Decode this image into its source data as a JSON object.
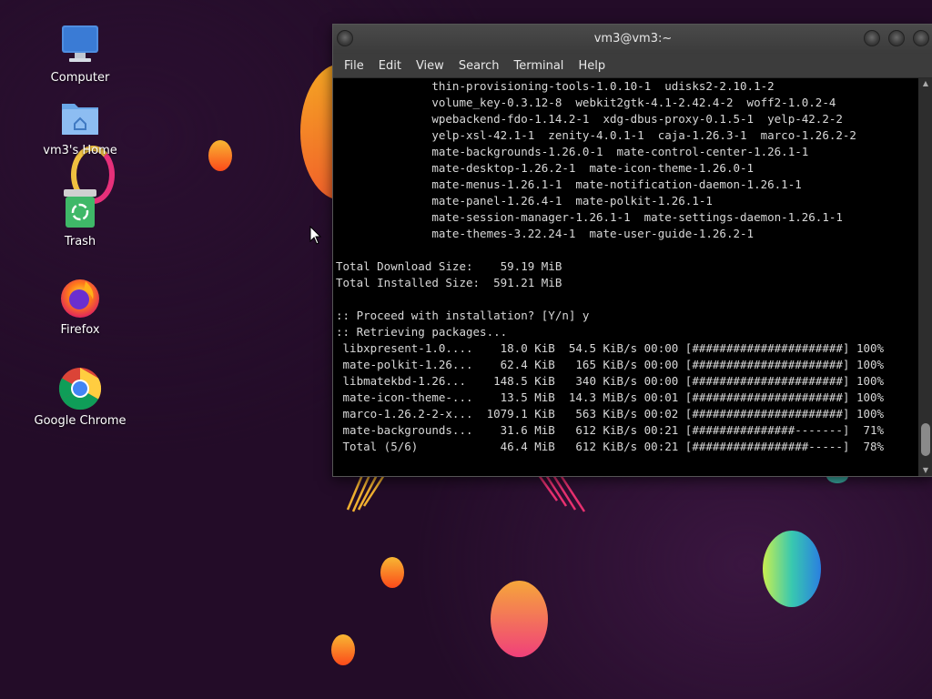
{
  "desktop": {
    "icons": [
      {
        "label": "Computer",
        "icon": "computer-icon"
      },
      {
        "label": "vm3's Home",
        "icon": "home-folder-icon"
      },
      {
        "label": "Trash",
        "icon": "trash-icon"
      },
      {
        "label": "Firefox",
        "icon": "firefox-icon"
      },
      {
        "label": "Google Chrome",
        "icon": "chrome-icon"
      }
    ]
  },
  "terminal": {
    "title": "vm3@vm3:~",
    "menu": [
      "File",
      "Edit",
      "View",
      "Search",
      "Terminal",
      "Help"
    ],
    "lines": [
      "              thin-provisioning-tools-1.0.10-1  udisks2-2.10.1-2",
      "              volume_key-0.3.12-8  webkit2gtk-4.1-2.42.4-2  woff2-1.0.2-4",
      "              wpebackend-fdo-1.14.2-1  xdg-dbus-proxy-0.1.5-1  yelp-42.2-2",
      "              yelp-xsl-42.1-1  zenity-4.0.1-1  caja-1.26.3-1  marco-1.26.2-2",
      "              mate-backgrounds-1.26.0-1  mate-control-center-1.26.1-1",
      "              mate-desktop-1.26.2-1  mate-icon-theme-1.26.0-1",
      "              mate-menus-1.26.1-1  mate-notification-daemon-1.26.1-1",
      "              mate-panel-1.26.4-1  mate-polkit-1.26.1-1",
      "              mate-session-manager-1.26.1-1  mate-settings-daemon-1.26.1-1",
      "              mate-themes-3.22.24-1  mate-user-guide-1.26.2-1",
      "",
      "Total Download Size:    59.19 MiB",
      "Total Installed Size:  591.21 MiB",
      "",
      ":: Proceed with installation? [Y/n] y",
      ":: Retrieving packages...",
      " libxpresent-1.0....    18.0 KiB  54.5 KiB/s 00:00 [######################] 100%",
      " mate-polkit-1.26...    62.4 KiB   165 KiB/s 00:00 [######################] 100%",
      " libmatekbd-1.26...    148.5 KiB   340 KiB/s 00:00 [######################] 100%",
      " mate-icon-theme-...    13.5 MiB  14.3 MiB/s 00:01 [######################] 100%",
      " marco-1.26.2-2-x...  1079.1 KiB   563 KiB/s 00:02 [######################] 100%",
      " mate-backgrounds...    31.6 MiB   612 KiB/s 00:21 [###############-------]  71%",
      " Total (5/6)            46.4 MiB   612 KiB/s 00:21 [#################-----]  78%"
    ]
  },
  "colors": {
    "terminal_bg": "#000000",
    "terminal_fg": "#d8d8d8",
    "titlebar": "#3b3b3b",
    "desktop_bg": "#230c28"
  }
}
